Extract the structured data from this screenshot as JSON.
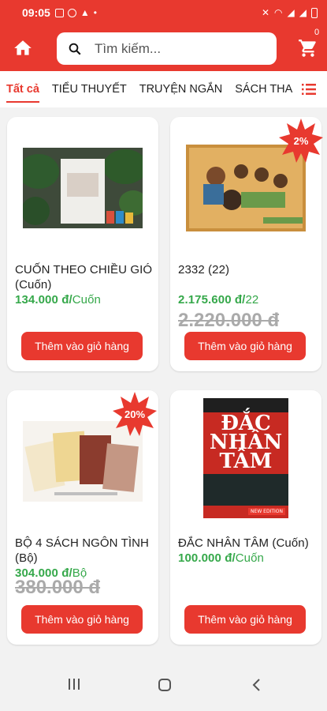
{
  "status": {
    "time": "09:05"
  },
  "header": {
    "search_placeholder": "Tìm kiếm...",
    "cart_count": "0"
  },
  "tabs": [
    "Tất cả",
    "TIỂU THUYẾT",
    "TRUYỆN NGẮN",
    "SÁCH THAM KHẢO"
  ],
  "products": [
    {
      "title": "CUỐN THEO CHIỀU GIÓ (Cuốn)",
      "price": "134.000 đ/",
      "unit": "Cuốn",
      "old_price": "",
      "badge": ""
    },
    {
      "title": "2332 (22)",
      "price": "2.175.600 đ/",
      "unit": "22",
      "old_price": "2.220.000 đ",
      "badge": "2%"
    },
    {
      "title": "BỘ 4 SÁCH NGÔN TÌNH (Bộ)",
      "price": "304.000 đ/",
      "unit": "Bộ",
      "old_price": "380.000 đ",
      "badge": "20%"
    },
    {
      "title": "ĐẮC NHÂN TÂM (Cuốn)",
      "price": "100.000 đ/",
      "unit": "Cuốn",
      "old_price": "",
      "badge": ""
    }
  ],
  "add_to_cart_label": "Thêm vào giỏ hàng",
  "book_cover": {
    "line1": "ĐẮC",
    "line2": "NHÂN",
    "line3": "TÂM",
    "edition": "NEW EDITION"
  },
  "colors": {
    "primary": "#e8392f",
    "price": "#35a84a"
  }
}
